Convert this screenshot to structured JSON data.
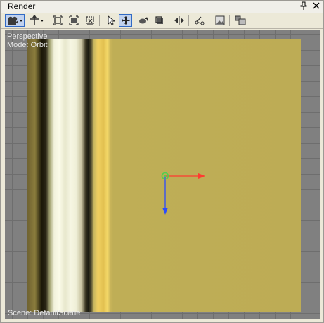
{
  "window": {
    "title": "Render",
    "pin_glyph": "⬚",
    "close_glyph": "✕"
  },
  "toolbar": {
    "buttons": [
      {
        "name": "camera-icon",
        "active": true
      },
      {
        "name": "navigate-icon"
      },
      {
        "name": "zoom-extents-icon"
      },
      {
        "name": "zoom-selected-icon"
      },
      {
        "name": "zoom-region-icon"
      },
      {
        "name": "select-arrow-icon"
      },
      {
        "name": "move-icon",
        "active": true
      },
      {
        "name": "rotate-icon"
      },
      {
        "name": "scale-icon"
      },
      {
        "name": "mirror-icon"
      },
      {
        "name": "bone-icon"
      },
      {
        "name": "render-image-icon"
      },
      {
        "name": "layout-icon"
      }
    ]
  },
  "viewport": {
    "view_label": "Perspective",
    "mode_label": "Mode: Orbit",
    "scene_label": "Scene: DefaultScene",
    "background_color": "#808080",
    "model_color": "#bdac55"
  },
  "gizmo": {
    "x_color": "#ff3b30",
    "y_color": "#2a4bff",
    "center_color": "#4fd04f"
  }
}
